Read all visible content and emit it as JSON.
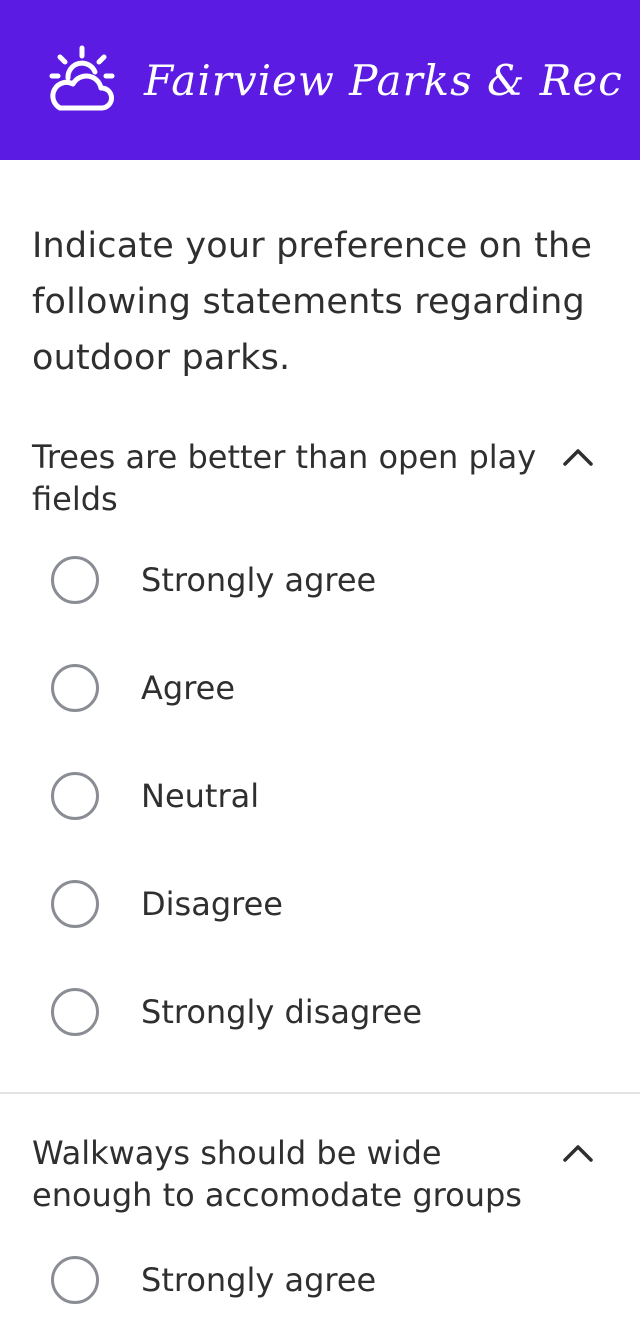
{
  "header": {
    "title": "Fairview Parks & Rec",
    "logo_icon": "sun-cloud-icon",
    "background_color": "#5b1be3"
  },
  "intro_text": "Indicate your preference on the following statements regarding outdoor parks.",
  "questions": [
    {
      "statement": "Trees are better than open play fields",
      "expanded": true,
      "options": [
        "Strongly agree",
        "Agree",
        "Neutral",
        "Disagree",
        "Strongly disagree"
      ]
    },
    {
      "statement": "Walkways should be wide enough to accomodate groups",
      "expanded": true,
      "options": [
        "Strongly agree"
      ]
    }
  ]
}
